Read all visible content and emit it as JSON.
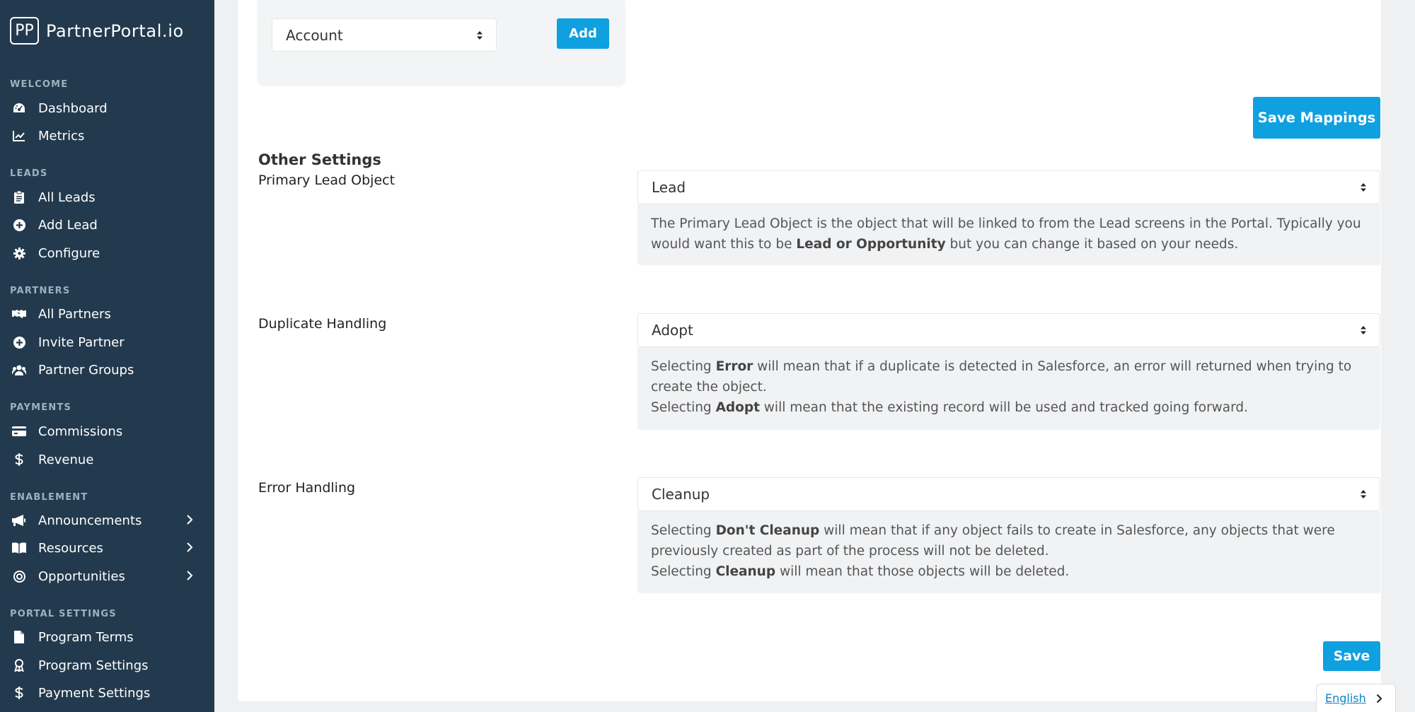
{
  "brand": {
    "logo_mark": "PP",
    "name": "PartnerPortal.io"
  },
  "sidebar": {
    "sections": [
      {
        "title": "WELCOME",
        "items": [
          {
            "label": "Dashboard",
            "icon": "dashboard-gauge-icon"
          },
          {
            "label": "Metrics",
            "icon": "chart-line-icon"
          }
        ]
      },
      {
        "title": "LEADS",
        "items": [
          {
            "label": "All Leads",
            "icon": "clipboard-icon"
          },
          {
            "label": "Add Lead",
            "icon": "plus-circle-icon"
          },
          {
            "label": "Configure",
            "icon": "gear-icon"
          }
        ]
      },
      {
        "title": "PARTNERS",
        "items": [
          {
            "label": "All Partners",
            "icon": "handshake-icon"
          },
          {
            "label": "Invite Partner",
            "icon": "plus-circle-icon"
          },
          {
            "label": "Partner Groups",
            "icon": "users-icon"
          }
        ]
      },
      {
        "title": "PAYMENTS",
        "items": [
          {
            "label": "Commissions",
            "icon": "credit-card-icon"
          },
          {
            "label": "Revenue",
            "icon": "dollar-icon"
          }
        ]
      },
      {
        "title": "ENABLEMENT",
        "items": [
          {
            "label": "Announcements",
            "icon": "megaphone-icon"
          },
          {
            "label": "Resources",
            "icon": "book-icon"
          },
          {
            "label": "Opportunities",
            "icon": "target-icon"
          }
        ]
      },
      {
        "title": "PORTAL SETTINGS",
        "items": [
          {
            "label": "Program Terms",
            "icon": "file-icon"
          },
          {
            "label": "Program Settings",
            "icon": "award-icon"
          },
          {
            "label": "Payment Settings",
            "icon": "dollar-icon"
          }
        ]
      }
    ]
  },
  "mapping": {
    "object_select": "Account",
    "add_label": "Add",
    "save_mappings_label": "Save Mappings"
  },
  "other_settings": {
    "heading": "Other Settings",
    "primary_lead": {
      "label": "Primary Lead Object",
      "value": "Lead",
      "help": {
        "t1": "The Primary Lead Object is the object that will be linked to from the Lead screens in the Portal. Typically you would want this to be ",
        "b1": "Lead or Opportunity",
        "t2": " but you can change it based on your needs."
      }
    },
    "duplicate": {
      "label": "Duplicate Handling",
      "value": "Adopt",
      "help": {
        "t1": "Selecting ",
        "b1": "Error",
        "t2": " will mean that if a duplicate is detected in Salesforce, an error will returned when trying to create the object.",
        "t3": "Selecting ",
        "b2": "Adopt",
        "t4": " will mean that the existing record will be used and tracked going forward."
      }
    },
    "error": {
      "label": "Error Handling",
      "value": "Cleanup",
      "help": {
        "t1": "Selecting ",
        "b1": "Don't Cleanup",
        "t2": " will mean that if any object fails to create in Salesforce, any objects that were previously created as part of the process will not be deleted.",
        "t3": "Selecting ",
        "b2": "Cleanup",
        "t4": " will mean that those objects will be deleted."
      }
    },
    "save_label": "Save"
  },
  "language": {
    "label": "English"
  }
}
